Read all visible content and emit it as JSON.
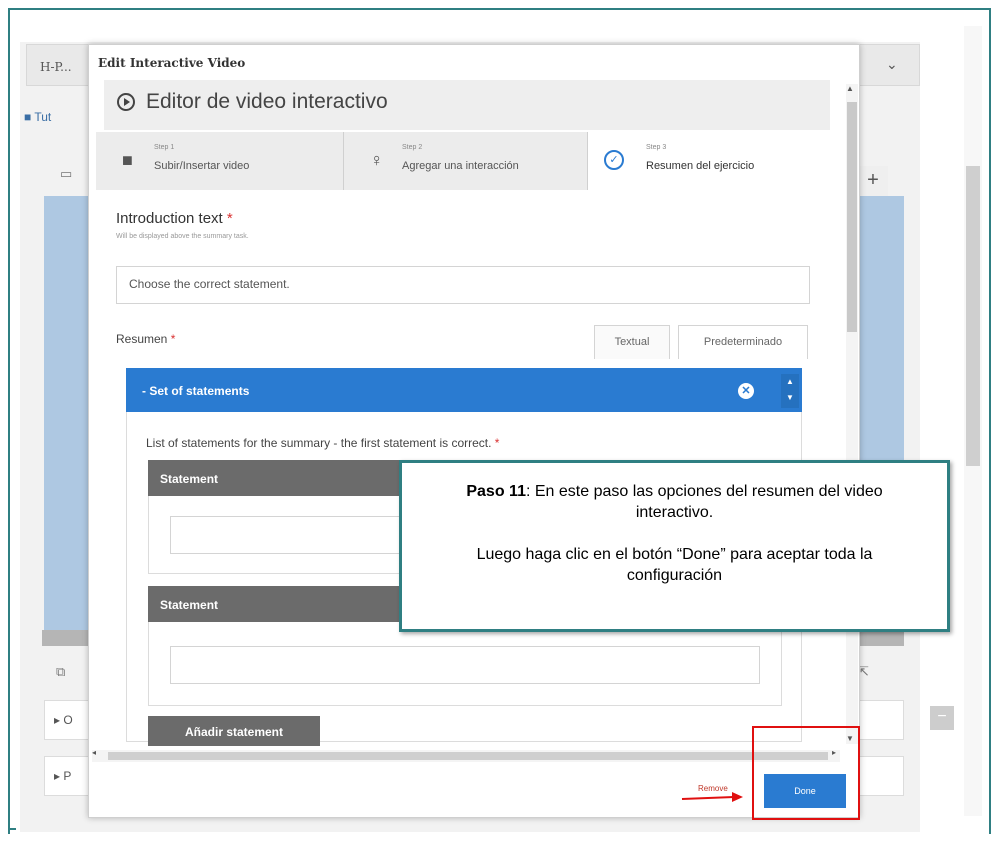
{
  "background": {
    "tab_label": "H-P...",
    "tut_label": "Tut",
    "row_labels": [
      "O",
      "P"
    ]
  },
  "dialog": {
    "title": "Edit Interactive Video",
    "editor_title": "Editor de video interactivo",
    "steps": [
      {
        "small": "Step 1",
        "label": "Subir/Insertar video",
        "icon": "video-camera-icon"
      },
      {
        "small": "Step 2",
        "label": "Agregar una interacción",
        "icon": "lightbulb-icon"
      },
      {
        "small": "Step 3",
        "label": "Resumen del ejercicio",
        "icon": "check-circle-icon",
        "active": true
      }
    ],
    "intro": {
      "label": "Introduction text",
      "required_mark": "*",
      "help": "Will be displayed above the summary task.",
      "value": "Choose the correct statement."
    },
    "resumen": {
      "label": "Resumen",
      "required_mark": "*",
      "mode_tabs": [
        "Textual",
        "Predeterminado"
      ]
    },
    "set": {
      "title": "Set of statements",
      "collapse_glyph": "-",
      "description": "List of statements for the summary - the first statement is correct.",
      "required_mark": "*",
      "statement_label_1": "Statement",
      "statement_label_2": "Statement",
      "add_button": "Añadir statement"
    },
    "footer": {
      "remove_label": "Remove",
      "done_label": "Done"
    }
  },
  "callout": {
    "step_bold": "Paso 11",
    "line1": ": En este paso las opciones del resumen del video interactivo.",
    "line2": "Luego haga clic en el botón “Done” para aceptar toda la configuración"
  },
  "colors": {
    "accent_blue": "#2a7bd1",
    "frame_teal": "#2f7f82",
    "highlight_red": "#e01010"
  }
}
